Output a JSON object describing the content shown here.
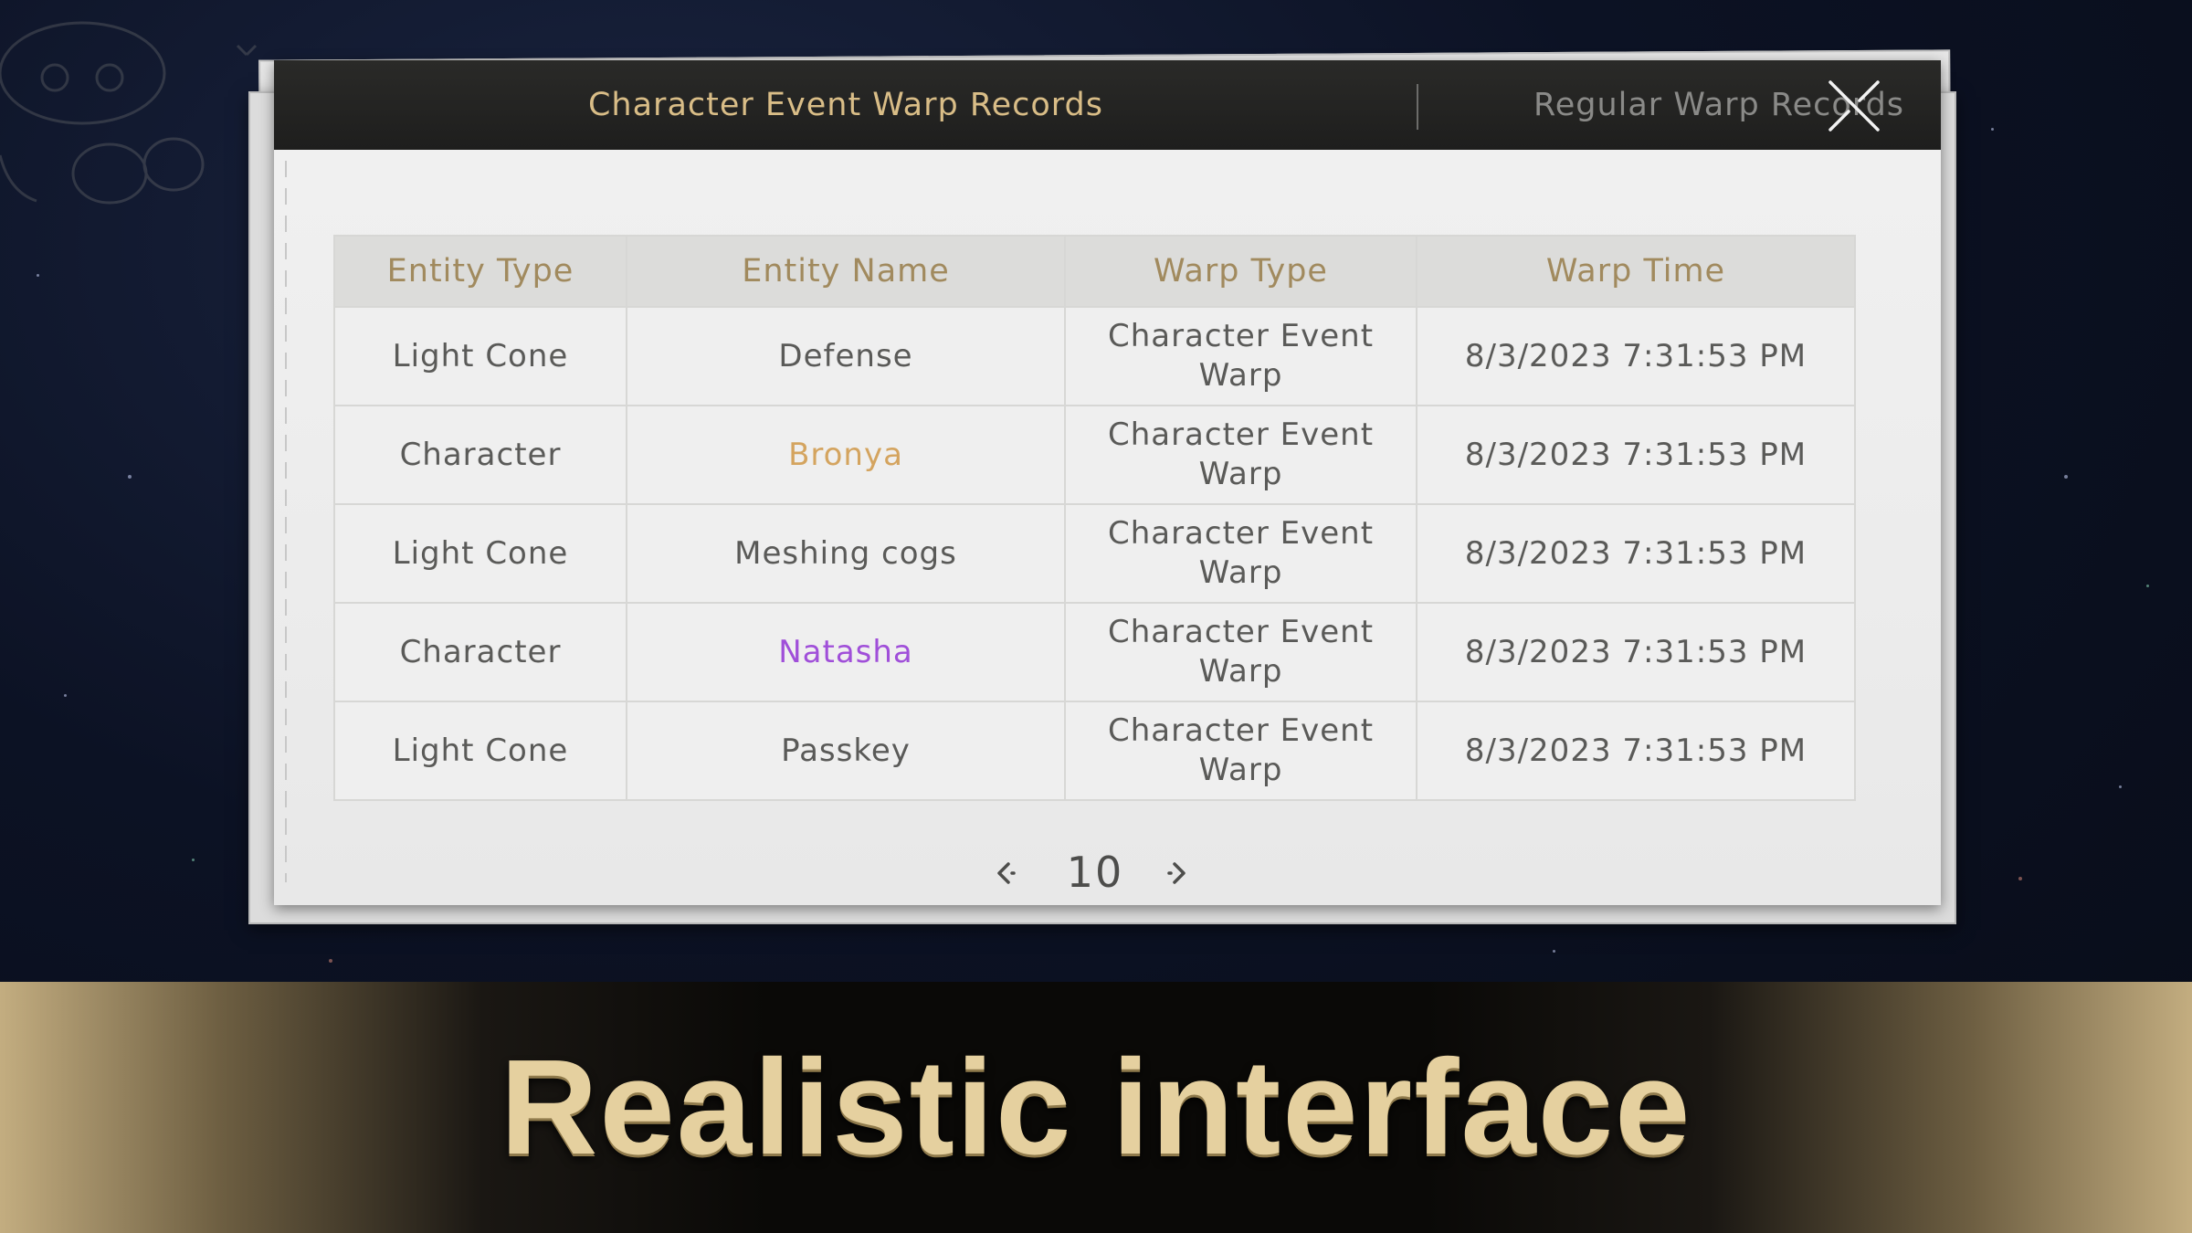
{
  "tabs": {
    "active_label": "Character Event Warp Records",
    "inactive_label": "Regular Warp Records"
  },
  "close_icon": "close-x-icon",
  "table": {
    "headers": [
      "Entity Type",
      "Entity Name",
      "Warp Type",
      "Warp Time"
    ],
    "rows": [
      {
        "entity_type": "Light Cone",
        "entity_name": "Defense",
        "warp_type": "Character Event Warp",
        "warp_time": "8/3/2023 7:31:53 PM",
        "name_color": "#5a5a58"
      },
      {
        "entity_type": "Character",
        "entity_name": "Bronya",
        "warp_type": "Character Event Warp",
        "warp_time": "8/3/2023 7:31:53 PM",
        "name_color": "#d4a45f"
      },
      {
        "entity_type": "Light Cone",
        "entity_name": "Meshing cogs",
        "warp_type": "Character Event Warp",
        "warp_time": "8/3/2023 7:31:53 PM",
        "name_color": "#5a5a58"
      },
      {
        "entity_type": "Character",
        "entity_name": "Natasha",
        "warp_type": "Character Event Warp",
        "warp_time": "8/3/2023 7:31:53 PM",
        "name_color": "#a04fd9"
      },
      {
        "entity_type": "Light Cone",
        "entity_name": "Passkey",
        "warp_type": "Character Event Warp",
        "warp_time": "8/3/2023 7:31:53 PM",
        "name_color": "#5a5a58"
      }
    ]
  },
  "pager": {
    "page": "10",
    "prev_icon": "chevron-left-icon",
    "next_icon": "chevron-right-icon"
  },
  "banner": {
    "text": "Realistic interface"
  },
  "colors": {
    "accent_gold": "#d9bd87",
    "header_text": "#a18a5e",
    "five_star": "#d4a45f",
    "four_star": "#a04fd9"
  }
}
